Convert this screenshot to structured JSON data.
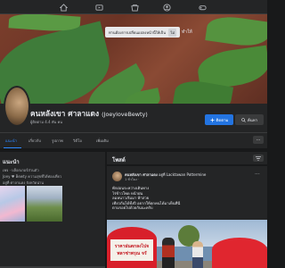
{
  "nav": {
    "icons": [
      "home-icon",
      "watch-icon",
      "marketplace-icon",
      "groups-icon",
      "gaming-icon"
    ]
  },
  "cover": {
    "promo_text": "ท่านต้องการเปลี่ยนแปลงหน้านี้ให้เป็นภาษา ไทย",
    "promo_button": "ไม่",
    "promo_extra": "ทำให้"
  },
  "profile": {
    "name": "คนหลังเขา ศาลาแดง",
    "alt_name": "(JoeyloveBewty)",
    "followers": "ผู้ติดตาม 4.4 พัน คน",
    "follow_label": "ติดตาม",
    "search_label": "ค้นหา"
  },
  "tabs": [
    "แนะนำ",
    "เกี่ยวกับ",
    "รูปภาพ",
    "วิดีโอ",
    "เพิ่มเติม"
  ],
  "about": {
    "title": "แนะนำ",
    "lines": [
      "เพจ · บล็อกเกอร์ส่วนตัว",
      "Joey ♥ Bewty ความสุขที่ได้ท่องเที่ยว",
      "อยู่ที่ ศาลาแดง จังหวัดน่าน"
    ]
  },
  "posts": {
    "title": "โพสต์",
    "filter_label": "ตัวกรอง",
    "item": {
      "author": "คนหลังเขา ศาลาแดง",
      "action": "อยู่ที่ Lacktawan Pottermine",
      "time": "1 ชั่วโมง ·",
      "lines": [
        "พักผ่อนระหว่างเดินทาง",
        "ไร่ข้าวโพด หน้าฝน",
        "ลมหนาวเริ่มมา ฟ้าสวย",
        "เที่ยวกันได้ทั้งปี อยากให้ทุกคนได้มาเห็นที่นี่",
        "ตามรอยไปด้วยกันนะครับ"
      ],
      "sign_lines": [
        "ราคาฝนตกลงไปจ",
        "พลาซ่าพรุณ จรั"
      ]
    }
  }
}
